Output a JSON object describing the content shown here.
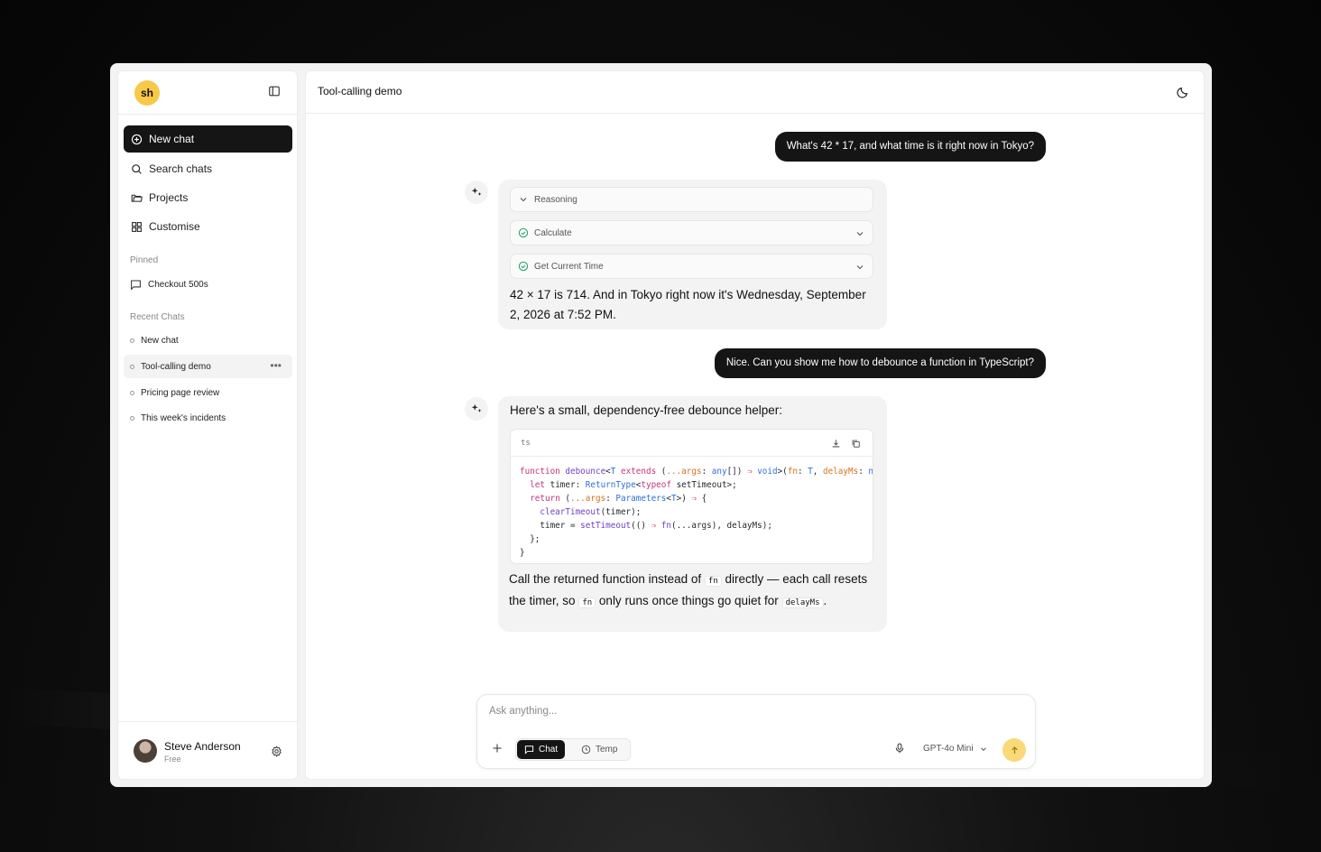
{
  "sidebar": {
    "logo_text": "sh",
    "nav": {
      "new_chat": "New chat",
      "search": "Search chats",
      "projects": "Projects",
      "customise": "Customise"
    },
    "pinned_label": "Pinned",
    "pinned_items": [
      "Checkout 500s"
    ],
    "recent_label": "Recent Chats",
    "recent_items": [
      "New chat",
      "Tool-calling demo",
      "Pricing page review",
      "This week's incidents"
    ],
    "user": {
      "name": "Steve Anderson",
      "plan": "Free"
    }
  },
  "header": {
    "title": "Tool-calling demo"
  },
  "messages": {
    "user1": "What's 42 * 17, and what time is it right now in Tokyo?",
    "tools": [
      "Reasoning",
      "Calculate",
      "Get Current Time"
    ],
    "ai1": "42 × 17 is 714. And in Tokyo right now it's Wednesday, September 2, 2026 at 7:52 PM.",
    "user2": "Nice. Can you show me how to debounce a function in TypeScript?",
    "ai2_intro": "Here's a small, dependency-free debounce helper:",
    "code_lang": "ts",
    "ai2_outro_1": "Call the returned function instead of",
    "ai2_code_fn": "fn",
    "ai2_outro_2": "directly — each call resets the timer, so",
    "ai2_outro_3": "only runs once things go quiet for",
    "ai2_code_delay": "delayMs",
    "ai2_outro_end": "."
  },
  "composer": {
    "placeholder": "Ask anything...",
    "mode_chat": "Chat",
    "mode_temp": "Temp",
    "model": "GPT-4o Mini"
  },
  "colors": {
    "accent": "#f7c948",
    "dark": "#151515",
    "success": "#22a06b"
  }
}
